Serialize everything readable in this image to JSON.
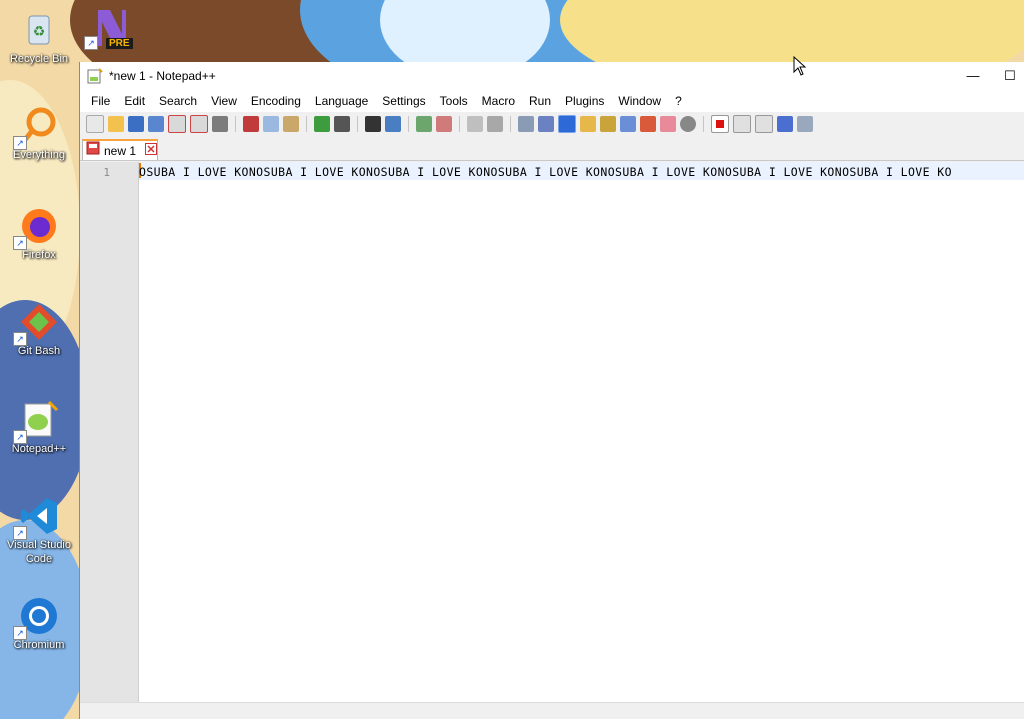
{
  "desktop": {
    "icons": [
      {
        "name": "recycle-bin",
        "label": "Recycle Bin"
      },
      {
        "name": "pre-app",
        "label": ""
      },
      {
        "name": "everything",
        "label": "Everything"
      },
      {
        "name": "firefox",
        "label": "Firefox"
      },
      {
        "name": "git-bash",
        "label": "Git Bash"
      },
      {
        "name": "notepadpp",
        "label": "Notepad++"
      },
      {
        "name": "vscode",
        "label": "Visual Studio Code"
      },
      {
        "name": "chromium",
        "label": "Chromium"
      }
    ],
    "pre_badge": "PRE"
  },
  "window": {
    "title": "*new 1 - Notepad++",
    "minimize": "—",
    "maximize": "☐"
  },
  "menu": [
    "File",
    "Edit",
    "Search",
    "View",
    "Encoding",
    "Language",
    "Settings",
    "Tools",
    "Macro",
    "Run",
    "Plugins",
    "Window",
    "?"
  ],
  "tabs": [
    {
      "label": "new 1"
    }
  ],
  "editor": {
    "line_number": "1",
    "line_text": "OSUBA I LOVE KONOSUBA I LOVE KONOSUBA I LOVE KONOSUBA I LOVE KONOSUBA I LOVE KONOSUBA I LOVE KONOSUBA I LOVE KO"
  },
  "colors": {
    "accent": "#f9a33a",
    "current_line": "#eaf2ff"
  }
}
